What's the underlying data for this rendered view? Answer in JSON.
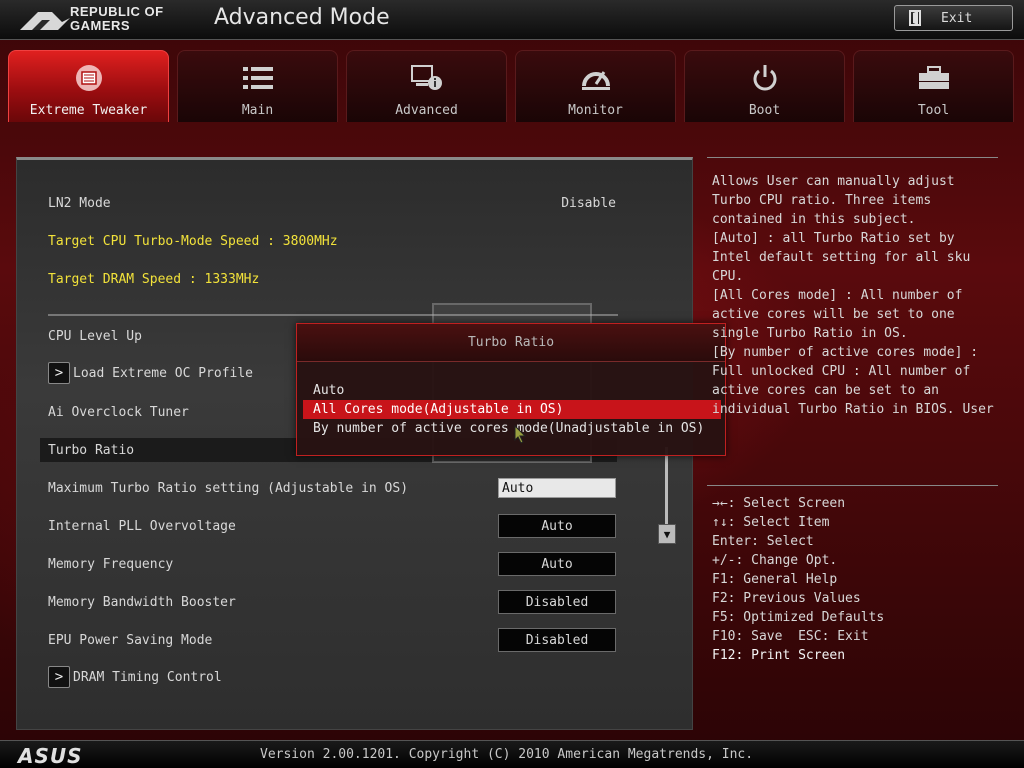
{
  "header": {
    "brand_line1": "REPUBLIC OF",
    "brand_line2": "GAMERS",
    "mode_title": "Advanced Mode",
    "exit_label": "Exit",
    "exit_icon": "exit-door-icon"
  },
  "tabs": [
    {
      "label": "Extreme Tweaker",
      "icon": "tweaker-chip-icon",
      "active": true
    },
    {
      "label": "Main",
      "icon": "list-icon",
      "active": false
    },
    {
      "label": "Advanced",
      "icon": "advanced-info-icon",
      "active": false
    },
    {
      "label": "Monitor",
      "icon": "gauge-icon",
      "active": false
    },
    {
      "label": "Boot",
      "icon": "power-icon",
      "active": false
    },
    {
      "label": "Tool",
      "icon": "toolbox-icon",
      "active": false
    }
  ],
  "main": {
    "ln2_mode_label": "LN2 Mode",
    "ln2_mode_value": "Disable",
    "target_cpu": "Target CPU Turbo-Mode Speed : 3800MHz",
    "target_dram": "Target DRAM Speed : 1333MHz",
    "cpu_level_up": "CPU Level Up",
    "load_extreme_oc": "Load Extreme OC Profile",
    "ai_overclock": "Ai Overclock Tuner",
    "turbo_ratio": "Turbo Ratio",
    "max_turbo_label": "Maximum Turbo Ratio setting (Adjustable in OS)",
    "max_turbo_value": "Auto",
    "pll_label": "Internal PLL Overvoltage",
    "pll_value": "Auto",
    "mem_freq_label": "Memory Frequency",
    "mem_freq_value": "Auto",
    "mem_bw_label": "Memory Bandwidth Booster",
    "mem_bw_value": "Disabled",
    "epu_label": "EPU Power Saving Mode",
    "epu_value": "Disabled",
    "dram_timing": "DRAM Timing Control",
    "submenu_arrow": ">"
  },
  "popup": {
    "title": "Turbo Ratio",
    "options": [
      "Auto",
      "All Cores mode(Adjustable in OS)",
      "By number of active cores mode(Unadjustable in OS)"
    ],
    "selected_index": 1
  },
  "help": {
    "text": "Allows User can manually adjust\nTurbo CPU ratio. Three items\ncontained in this subject.\n[Auto] : all Turbo Ratio set by\nIntel default setting for all sku\nCPU.\n[All Cores mode] : All number of\nactive cores will be set to one\nsingle Turbo Ratio in OS.\n[By number of active cores mode] :\nFull unlocked CPU : All number of\nactive cores can be set to an\nindividual Turbo Ratio in BIOS. User",
    "keys": [
      "→←: Select Screen",
      "↑↓: Select Item",
      "Enter: Select",
      "+/-: Change Opt.",
      "F1: General Help",
      "F2: Previous Values",
      "F5: Optimized Defaults",
      "F10: Save  ESC: Exit",
      "F12: Print Screen"
    ]
  },
  "footer": {
    "brand": "ASUS",
    "version": "Version 2.00.1201. Copyright (C) 2010 American Megatrends, Inc."
  },
  "colors": {
    "accent_red": "#c8141a",
    "highlight_yellow": "#f2e23a"
  }
}
